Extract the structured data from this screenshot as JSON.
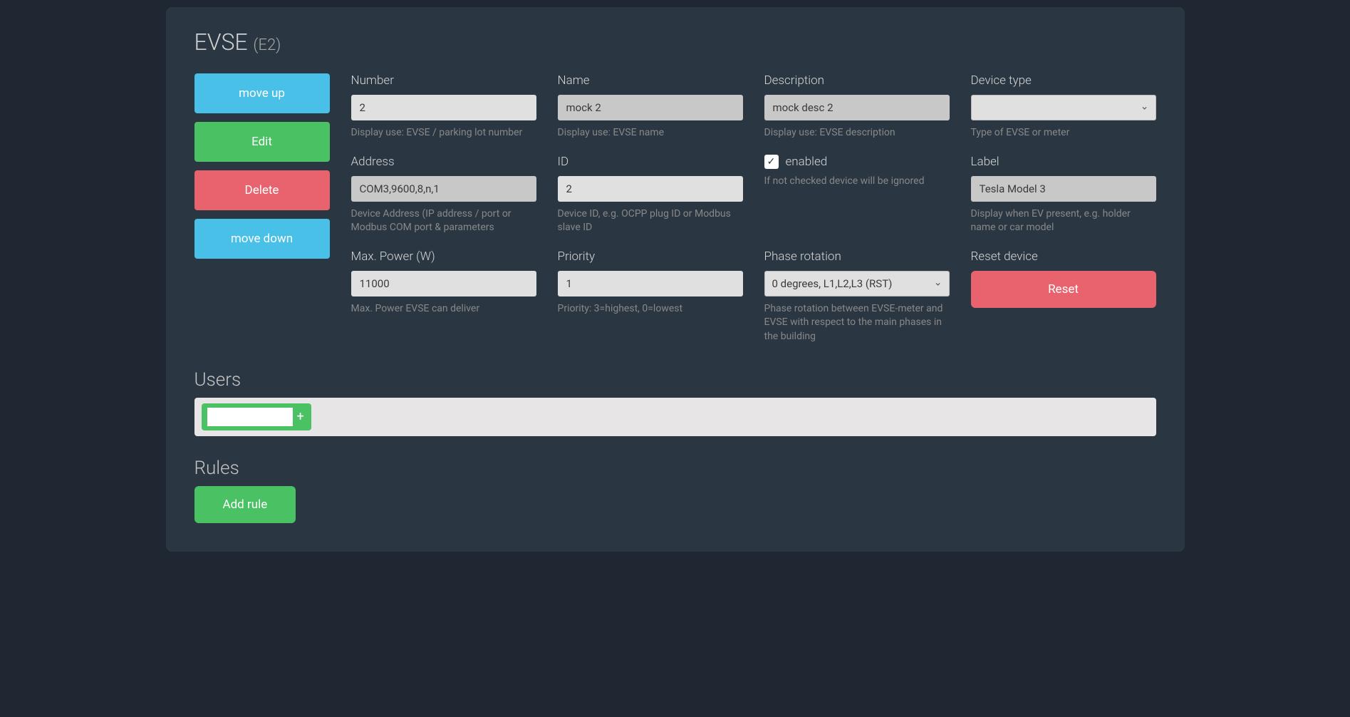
{
  "header": {
    "title": "EVSE",
    "subtitle": "(E2)"
  },
  "actions": {
    "move_up": "move up",
    "edit": "Edit",
    "delete": "Delete",
    "move_down": "move down"
  },
  "fields": {
    "number": {
      "label": "Number",
      "value": "2",
      "help": "Display use: EVSE / parking lot number"
    },
    "name": {
      "label": "Name",
      "value": "mock 2",
      "help": "Display use: EVSE name"
    },
    "description": {
      "label": "Description",
      "value": "mock desc 2",
      "help": "Display use: EVSE description"
    },
    "device_type": {
      "label": "Device type",
      "value": "",
      "help": "Type of EVSE or meter"
    },
    "address": {
      "label": "Address",
      "value": "COM3,9600,8,n,1",
      "help": "Device Address (IP address / port or Modbus COM port & parameters"
    },
    "id": {
      "label": "ID",
      "value": "2",
      "help": "Device ID, e.g. OCPP plug ID or Modbus slave ID"
    },
    "enabled": {
      "label": "enabled",
      "checked": true,
      "help": "If not checked device will be ignored"
    },
    "label": {
      "label": "Label",
      "value": "Tesla Model 3",
      "help": "Display when EV present, e.g. holder name or car model"
    },
    "max_power": {
      "label": "Max. Power (W)",
      "value": "11000",
      "help": "Max. Power EVSE can deliver"
    },
    "priority": {
      "label": "Priority",
      "value": "1",
      "help": "Priority: 3=highest, 0=lowest"
    },
    "phase_rotation": {
      "label": "Phase rotation",
      "value": "0 degrees, L1,L2,L3 (RST)",
      "help": "Phase rotation between EVSE-meter and EVSE with respect to the main phases in the building"
    },
    "reset": {
      "label": "Reset device",
      "button": "Reset"
    }
  },
  "users": {
    "title": "Users",
    "add_icon": "+"
  },
  "rules": {
    "title": "Rules",
    "add_button": "Add rule"
  }
}
